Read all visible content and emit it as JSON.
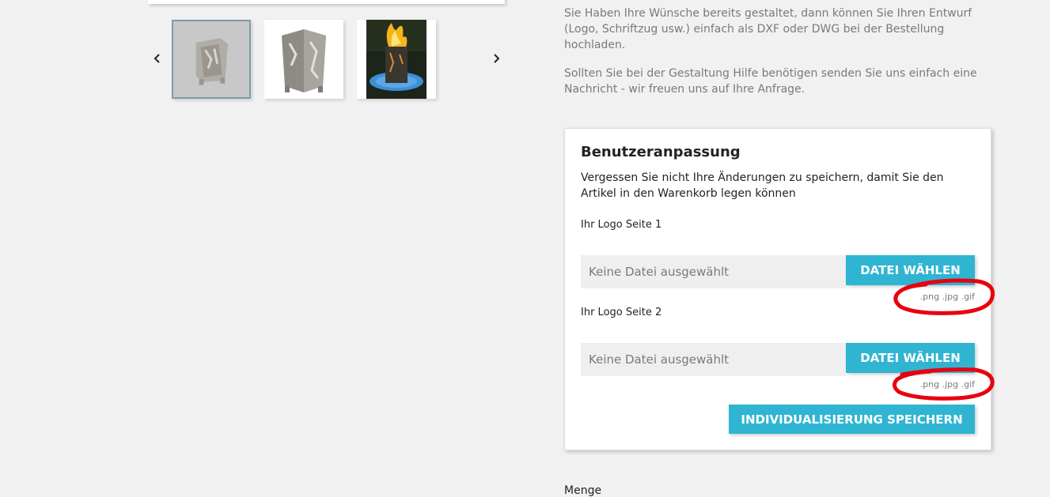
{
  "gallery": {
    "prev_icon": "chevron-left-icon",
    "next_icon": "chevron-right-icon",
    "thumbnails": [
      {
        "name": "fire-basket-front-thumbnail",
        "selected": true
      },
      {
        "name": "fire-basket-angle-thumbnail",
        "selected": false
      },
      {
        "name": "fire-basket-burning-thumbnail",
        "selected": false
      }
    ]
  },
  "description": {
    "paragraph_1": "Sie Haben Ihre Wünsche bereits gestaltet, dann können Sie Ihren Entwurf (Logo, Schriftzug usw.) einfach als DXF oder DWG bei der Bestellung hochladen.",
    "paragraph_2": "Sollten Sie bei der Gestaltung Hilfe benötigen senden Sie uns einfach eine Nachricht - wir freuen uns auf Ihre Anfrage."
  },
  "customization": {
    "title": "Benutzeranpassung",
    "note": "Vergessen Sie nicht Ihre Änderungen zu speichern, damit Sie den Artikel in den Warenkorb legen können",
    "fields": [
      {
        "label": "Ihr Logo Seite 1",
        "placeholder": "Keine Datei ausgewählt",
        "button": "DATEI WÄHLEN",
        "hint": ".png .jpg .gif"
      },
      {
        "label": "Ihr Logo Seite 2",
        "placeholder": "Keine Datei ausgewählt",
        "button": "DATEI WÄHLEN",
        "hint": ".png .jpg .gif"
      }
    ],
    "save_button": "INDIVIDUALISIERUNG SPEICHERN"
  },
  "quantity_label": "Menge",
  "colors": {
    "accent": "#2fb5d2",
    "annotation": "#e8000f",
    "background": "#f1f1f1"
  }
}
